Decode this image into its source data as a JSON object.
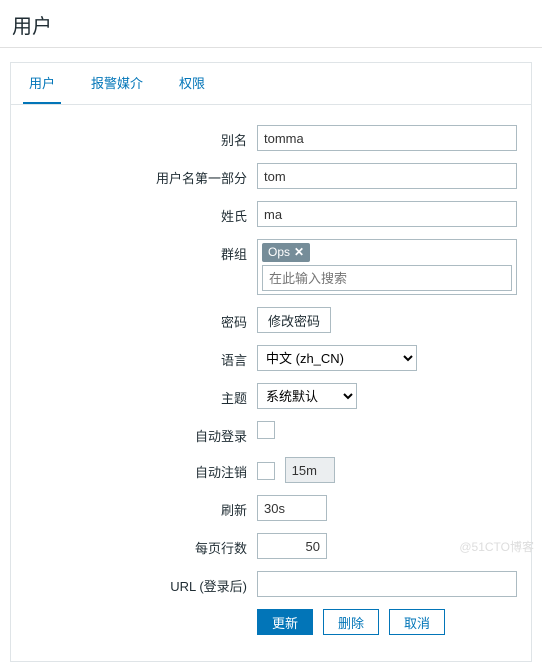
{
  "page": {
    "title": "用户"
  },
  "tabs": {
    "user": "用户",
    "media": "报警媒介",
    "perm": "权限"
  },
  "labels": {
    "alias": "别名",
    "name_first": "用户名第一部分",
    "surname": "姓氏",
    "groups": "群组",
    "password": "密码",
    "language": "语言",
    "theme": "主题",
    "autologin": "自动登录",
    "autologout": "自动注销",
    "refresh": "刷新",
    "rows": "每页行数",
    "url": "URL (登录后)"
  },
  "values": {
    "alias": "tomma",
    "name_first": "tom",
    "surname": "ma",
    "group_tag": "Ops",
    "group_placeholder": "在此输入搜索",
    "change_password": "修改密码",
    "language_selected": "中文 (zh_CN)",
    "theme_selected": "系统默认",
    "autologout_time": "15m",
    "refresh": "30s",
    "rows": "50",
    "url": ""
  },
  "buttons": {
    "update": "更新",
    "delete": "删除",
    "cancel": "取消"
  },
  "watermark": "@51CTO博客"
}
